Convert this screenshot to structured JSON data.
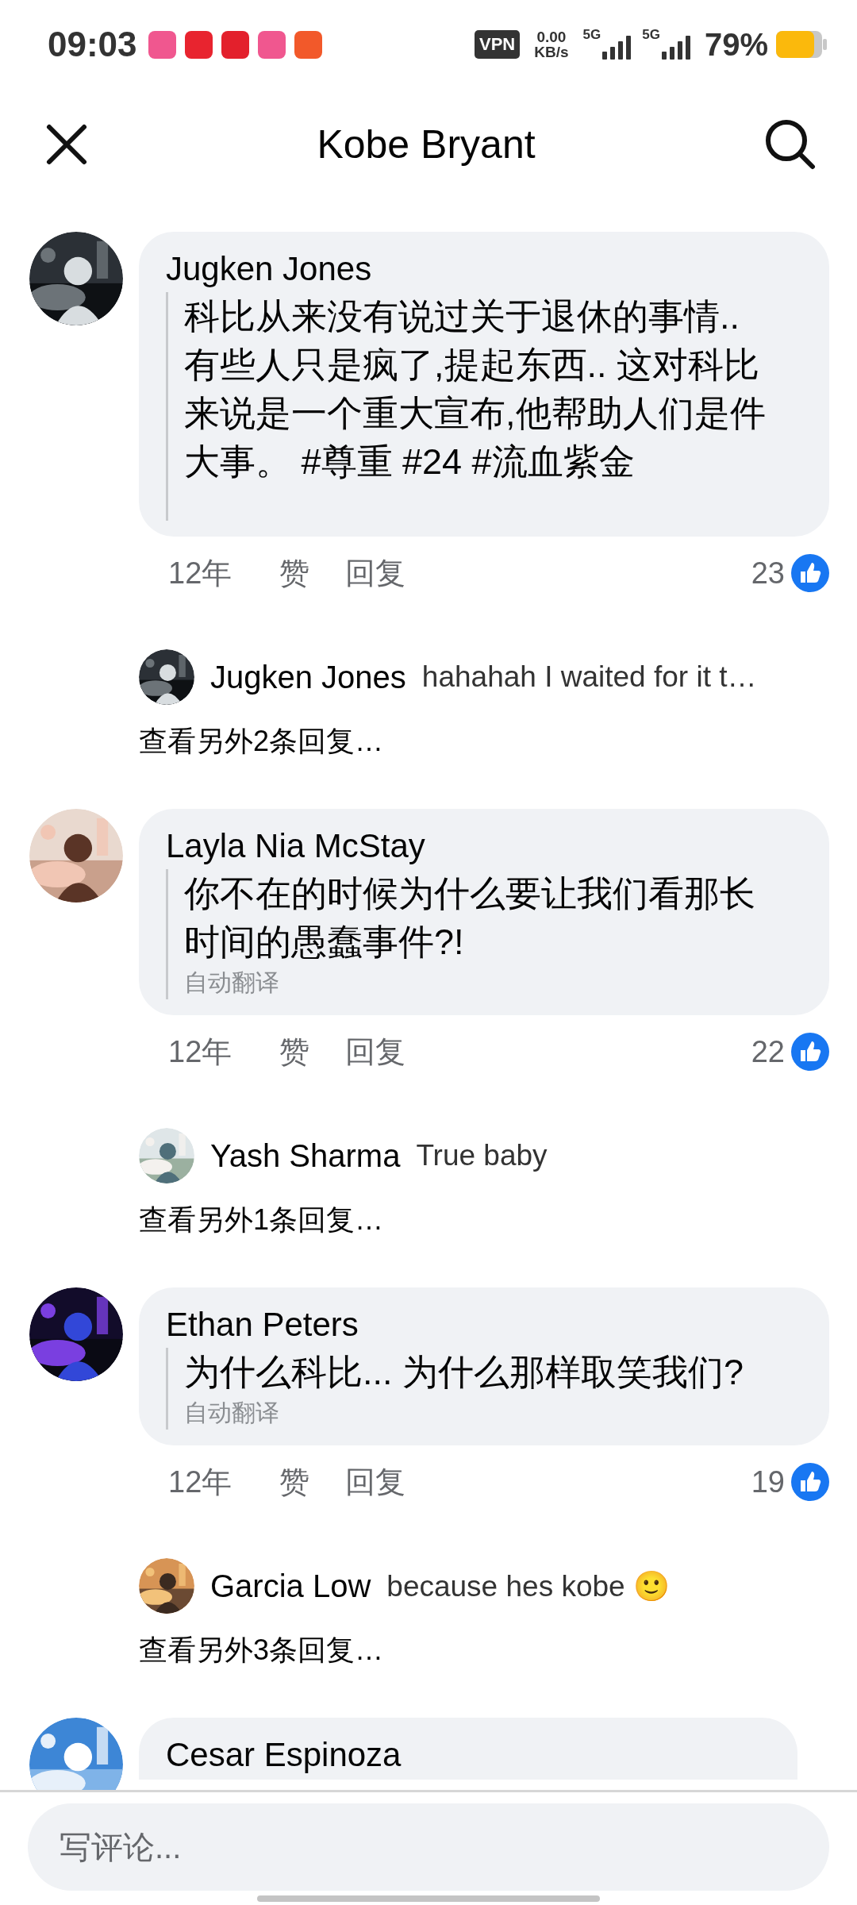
{
  "status_bar": {
    "time": "09:03",
    "vpn": "VPN",
    "speed_value": "0.00",
    "speed_unit": "KB/s",
    "networks": [
      "5G",
      "5G"
    ],
    "battery": "79%"
  },
  "header": {
    "title": "Kobe Bryant"
  },
  "comments": [
    {
      "author": "Jugken Jones",
      "text": "科比从来没有说过关于退休的事情.. 有些人只是疯了,提起东西.. 这对科比来说是一个重大宣布,他帮助人们是件大事。 #尊重 #24 #流血紫金",
      "time": "12年",
      "like": "赞",
      "reply": "回复",
      "likes": "23",
      "reply_preview": {
        "author": "Jugken Jones",
        "text": "hahahah I waited for it t…"
      },
      "more_replies": "查看另外2条回复…"
    },
    {
      "author": "Layla Nia McStay",
      "text": "你不在的时候为什么要让我们看那长时间的愚蠢事件?!",
      "translation": "自动翻译",
      "time": "12年",
      "like": "赞",
      "reply": "回复",
      "likes": "22",
      "reply_preview": {
        "author": "Yash Sharma",
        "text": "True baby"
      },
      "more_replies": "查看另外1条回复…"
    },
    {
      "author": "Ethan Peters",
      "text": "为什么科比... 为什么那样取笑我们?",
      "translation": "自动翻译",
      "time": "12年",
      "like": "赞",
      "reply": "回复",
      "likes": "19",
      "reply_preview": {
        "author": "Garcia Low",
        "text": "because hes kobe 🙂"
      },
      "more_replies": "查看另外3条回复…"
    },
    {
      "author": "Cesar Espinoza"
    }
  ],
  "composer": {
    "placeholder": "写评论..."
  }
}
